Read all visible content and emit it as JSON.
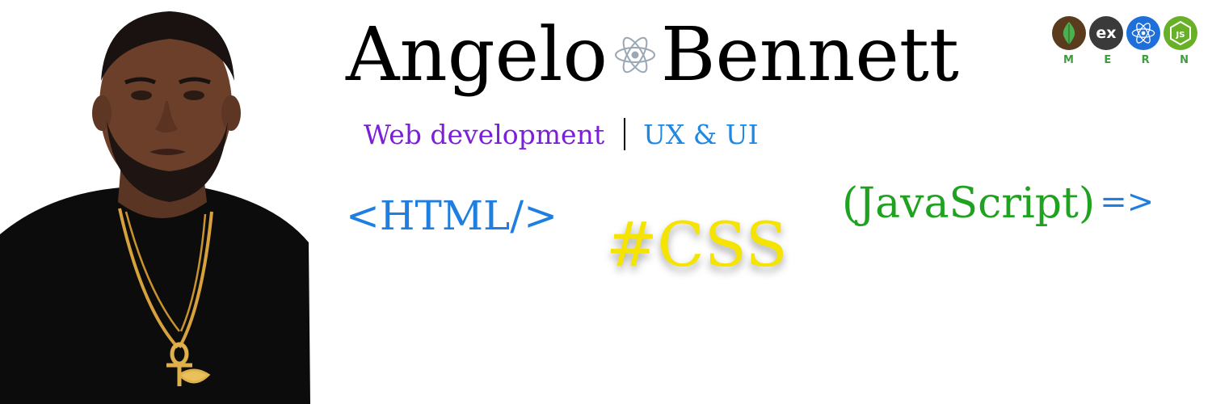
{
  "name": {
    "first": "Angelo",
    "last": "Bennett"
  },
  "tagline": {
    "primary": "Web development",
    "secondary": "UX & UI"
  },
  "skills": {
    "html": "<HTML/>",
    "css": "#CSS",
    "javascript": "(JavaScript)",
    "javascript_arrow": "=>"
  },
  "stack_badge": {
    "letters": [
      "M",
      "E",
      "R",
      "N"
    ],
    "express_label": "ex",
    "node_label": "JS",
    "icons": [
      "mongodb-leaf-icon",
      "express-icon",
      "react-atom-icon",
      "nodejs-hexagon-icon"
    ]
  },
  "colors": {
    "purple": "#7b1fd9",
    "blue": "#1e88e5",
    "yellow": "#f5e400",
    "green": "#1fa21f"
  }
}
